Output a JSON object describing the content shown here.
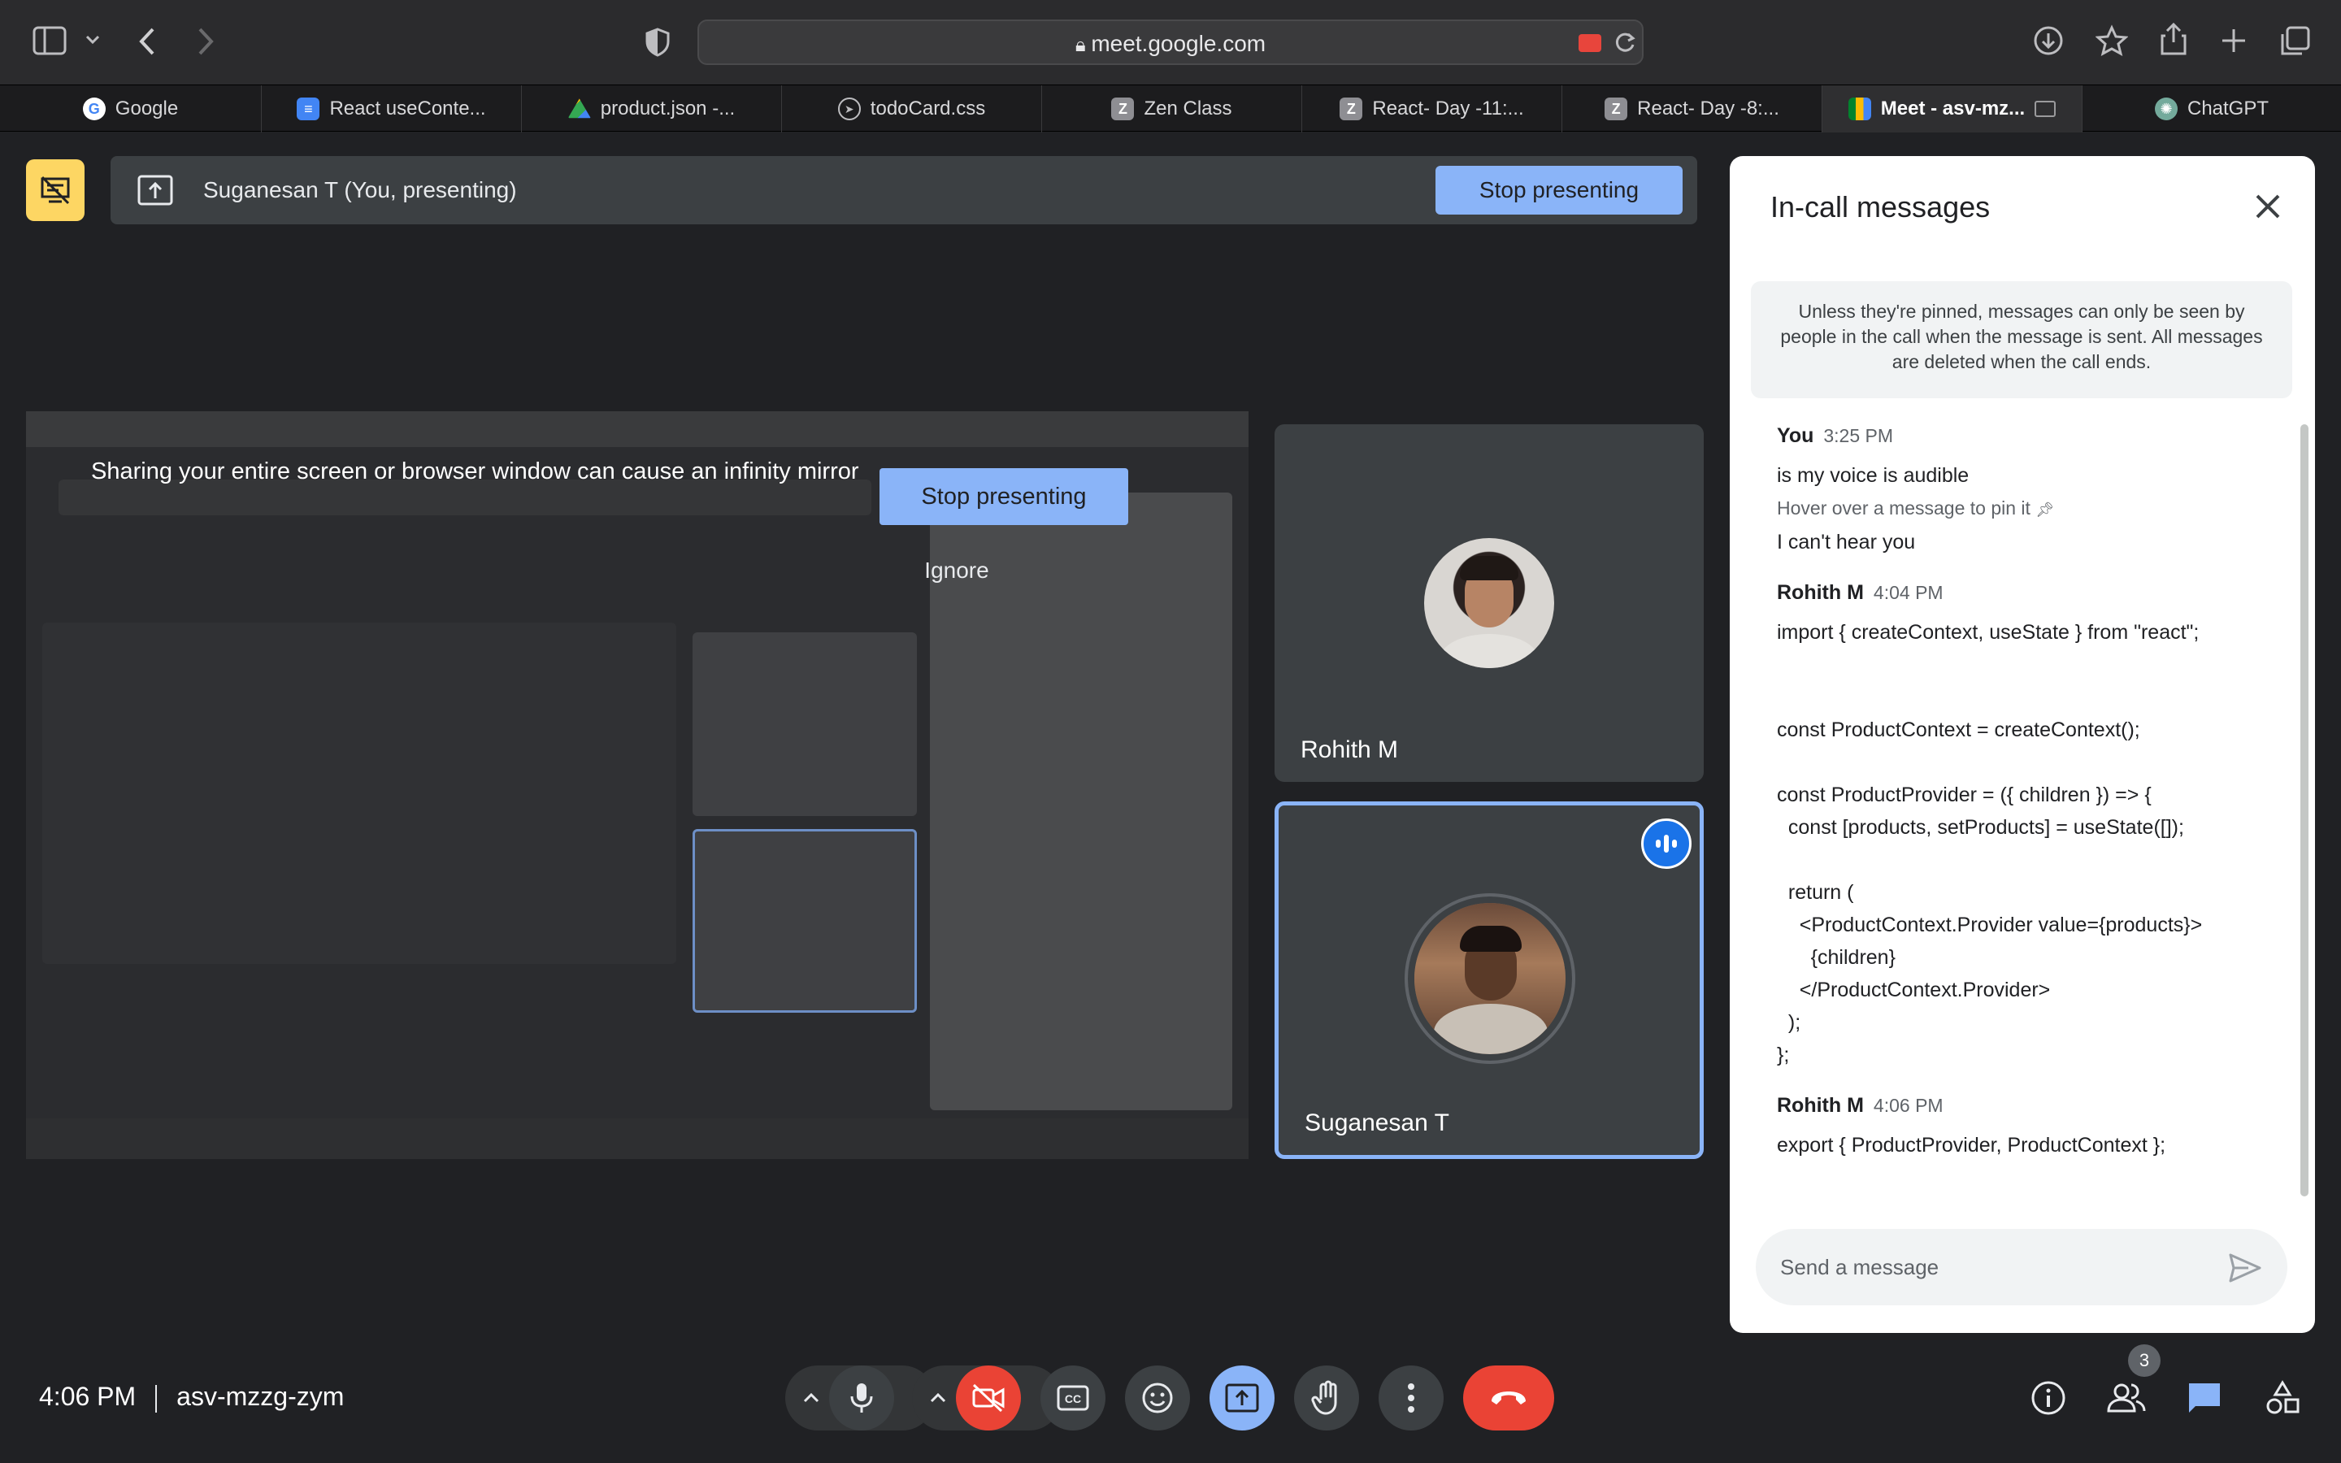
{
  "browser": {
    "url": "meet.google.com",
    "tabs": [
      {
        "label": "Google",
        "icon": "google-icon",
        "active": false
      },
      {
        "label": "React useConte...",
        "icon": "docs-icon",
        "active": false
      },
      {
        "label": "product.json -...",
        "icon": "drive-icon",
        "active": false
      },
      {
        "label": "todoCard.css",
        "icon": "compass-icon",
        "active": false
      },
      {
        "label": "Zen Class",
        "icon": "z-icon",
        "active": false
      },
      {
        "label": "React- Day -11:...",
        "icon": "z-icon",
        "active": false
      },
      {
        "label": "React- Day -8:...",
        "icon": "z-icon",
        "active": false
      },
      {
        "label": "Meet - asv-mz...",
        "icon": "meet-icon",
        "active": true
      },
      {
        "label": "ChatGPT",
        "icon": "chatgpt-icon",
        "active": false
      }
    ]
  },
  "presenting": {
    "banner_text": "Suganesan T (You, presenting)",
    "stop_label": "Stop presenting"
  },
  "mirror": {
    "warning": "Sharing your entire screen or browser window can cause an infinity mirror",
    "stop_label": "Stop presenting",
    "ignore_label": "Ignore"
  },
  "participants": [
    {
      "name": "Rohith M"
    },
    {
      "name": "Suganesan T"
    }
  ],
  "chat": {
    "title": "In-call messages",
    "notice": "Unless they're pinned, messages can only be seen by people in the call when the message is sent. All messages are deleted when the call ends.",
    "hint": "Hover over a message to pin it",
    "messages": [
      {
        "sender": "You",
        "time": "3:25 PM",
        "lines": [
          "is my voice is audible"
        ]
      },
      {
        "sender": "Rohith M",
        "time": "4:04 PM",
        "lines": [
          "import { createContext, useState } from \"react\";",
          "",
          "",
          "const ProductContext = createContext();",
          "",
          "const ProductProvider = ({ children }) => {",
          "  const [products, setProducts] = useState([]);",
          "",
          "  return (",
          "    <ProductContext.Provider value={products}>",
          "      {children}",
          "    </ProductContext.Provider>",
          "  );",
          "};"
        ]
      },
      {
        "sender": "Rohith M",
        "time": "4:06 PM",
        "lines": [
          "export { ProductProvider, ProductContext };"
        ]
      }
    ],
    "you_second_line": "I can't hear you",
    "input_placeholder": "Send a message"
  },
  "meeting": {
    "time": "4:06 PM",
    "code": "asv-mzzg-zym",
    "people_count": "3"
  },
  "colors": {
    "accent": "#8ab4f8",
    "end_call": "#ea4335",
    "cam_off": "#ea4335",
    "badge": "#fdd663"
  }
}
